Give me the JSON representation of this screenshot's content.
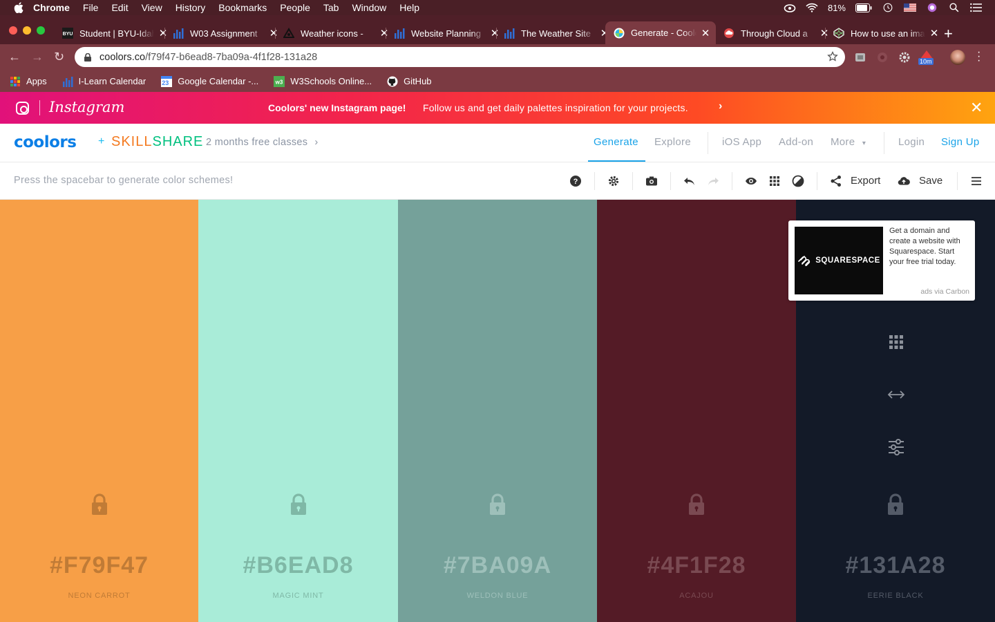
{
  "menubar": {
    "app": "Chrome",
    "items": [
      "File",
      "Edit",
      "View",
      "History",
      "Bookmarks",
      "People",
      "Tab",
      "Window",
      "Help"
    ],
    "battery": "81%"
  },
  "tabs": [
    {
      "title": "Student | BYU-Idaho",
      "icon": "byu-icon"
    },
    {
      "title": "W03 Assignment",
      "icon": "chart-icon"
    },
    {
      "title": "Weather icons - ",
      "icon": "weather-icon"
    },
    {
      "title": "Website Planning",
      "icon": "chart-icon"
    },
    {
      "title": "The Weather Site",
      "icon": "chart-icon"
    },
    {
      "title": "Generate - Coolors",
      "icon": "coolors-icon",
      "active": true
    },
    {
      "title": "Through Cloud a",
      "icon": "cloud-icon"
    },
    {
      "title": "How to use an image",
      "icon": "codepen-icon"
    }
  ],
  "address": {
    "host": "coolors.co",
    "path": "/f79f47-b6ead8-7ba09a-4f1f28-131a28"
  },
  "extensions": {
    "badge": "10m"
  },
  "bookmarks": [
    {
      "label": "Apps",
      "icon": "apps-grid-icon"
    },
    {
      "label": "I-Learn Calendar",
      "icon": "chart-icon"
    },
    {
      "label": "Google Calendar -...",
      "icon": "calendar-icon",
      "badge": "23"
    },
    {
      "label": "W3Schools Online...",
      "icon": "w3schools-icon"
    },
    {
      "label": "GitHub",
      "icon": "github-icon"
    }
  ],
  "promo": {
    "brand": "Instagram",
    "headline": "Coolors' new Instagram page!",
    "text": "Follow us and get daily palettes inspiration for your projects."
  },
  "header": {
    "logo": "coolors",
    "plus": "+",
    "partner_a": "SKILL",
    "partner_b": "SHARE",
    "offer": "2 months free classes",
    "nav": {
      "generate": "Generate",
      "explore": "Explore",
      "ios": "iOS App",
      "addon": "Add-on",
      "more": "More",
      "login": "Login",
      "signup": "Sign Up"
    }
  },
  "palbar": {
    "hint": "Press the spacebar to generate color schemes!",
    "export": "Export",
    "save": "Save"
  },
  "palette": [
    {
      "hex": "#F79F47",
      "name": "NEON CARROT",
      "bg": "#F79F47",
      "fg": "#c07b36"
    },
    {
      "hex": "#B6EAD8",
      "name": "MAGIC MINT",
      "bg": "#A9ECD8",
      "fg": "#7fb8a6"
    },
    {
      "hex": "#7BA09A",
      "name": "WELDON BLUE",
      "bg": "#75A19A",
      "fg": "#9ec0ba"
    },
    {
      "hex": "#4F1F28",
      "name": "ACAJOU",
      "bg": "#541B26",
      "fg": "#7a4a52"
    },
    {
      "hex": "#131A28",
      "name": "EERIE BLACK",
      "bg": "#131A28",
      "fg": "#545b68"
    }
  ],
  "ad": {
    "brand": "SQUARESPACE",
    "text": "Get a domain and create a website with Squarespace. Start your free trial today.",
    "via": "ads via Carbon"
  }
}
